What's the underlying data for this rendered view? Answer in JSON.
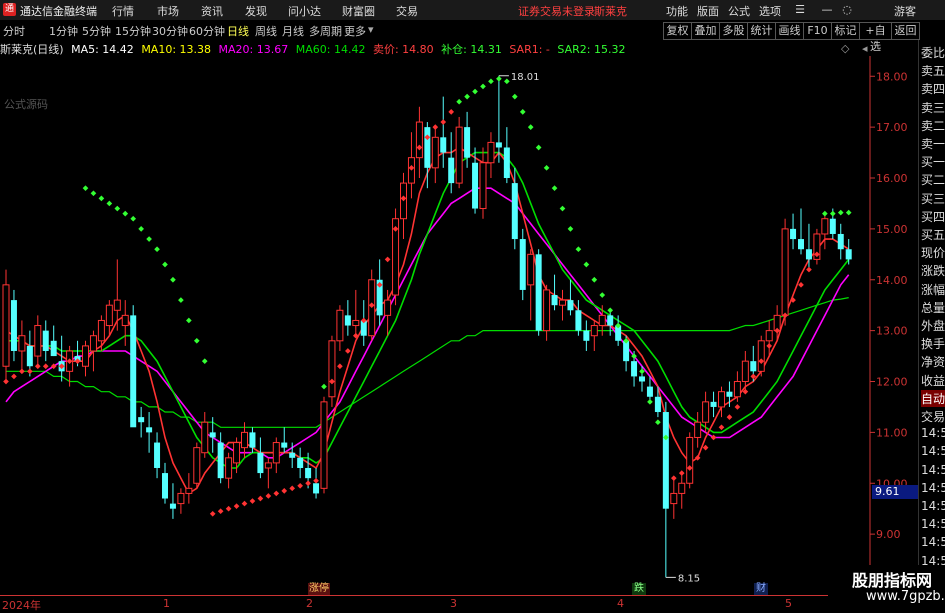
{
  "app": {
    "title": "通达信金融终端",
    "menu": [
      "行情",
      "市场",
      "资讯",
      "发现",
      "问小达",
      "财富圈",
      "交易"
    ],
    "notice": "证券交易未登录",
    "stock_name": "斯莱克",
    "right_menu": [
      "功能",
      "版面",
      "公式",
      "选项"
    ],
    "user": "游客"
  },
  "periods": [
    "分时",
    "1分钟",
    "5分钟",
    "15分钟",
    "30分钟",
    "60分钟",
    "日线",
    "周线",
    "月线",
    "多周期",
    "更多"
  ],
  "active_period": "日线",
  "toolbar": [
    "复权",
    "叠加",
    "多股",
    "统计",
    "画线",
    "F10",
    "标记",
    "+自选",
    "返回"
  ],
  "legend": {
    "name": "斯莱克(日线)",
    "ma5": "MA5: 14.42",
    "ma10": "MA10: 13.38",
    "ma20": "MA20: 13.67",
    "ma60": "MA60: 14.42",
    "sell": "卖价: 14.80",
    "add": "补仓: 14.31",
    "sar1": "SAR1: -",
    "sar2": "SAR2: 15.32",
    "formula_label": "公式源码"
  },
  "annotations": {
    "high": "18.01",
    "low": "8.15",
    "current": "9.61"
  },
  "yaxis": [
    "18.00",
    "17.00",
    "16.00",
    "15.00",
    "14.00",
    "13.00",
    "12.00",
    "11.00",
    "10.00",
    "9.00"
  ],
  "yvalues": [
    18,
    17,
    16,
    15,
    14,
    13,
    12,
    11,
    10,
    9
  ],
  "xaxis": [
    "2024年",
    "1",
    "2",
    "3",
    "4",
    "5"
  ],
  "events": [
    "涨停",
    "跌",
    "财"
  ],
  "right_panel": [
    "委比",
    "卖五",
    "卖四",
    "卖三",
    "卖二",
    "卖一",
    "买一",
    "买二",
    "买三",
    "买四",
    "买五",
    "现价",
    "涨跌",
    "涨幅",
    "总量",
    "外盘",
    "换手",
    "净资",
    "收益",
    "自动",
    "交易",
    "14:56",
    "14:56",
    "14:56",
    "14:56",
    "14:56",
    "14:56",
    "14:56",
    "14:56",
    "14:56"
  ],
  "watermark": {
    "line1": "股朋指标网",
    "line2": "www.7gpzb.com"
  },
  "colors": {
    "up": "#ff3333",
    "down": "#55ffff",
    "ma5": "#ffffff",
    "ma10": "#ffff00",
    "ma20": "#ff00ff",
    "ma60": "#00dd00",
    "sar_green": "#33ff33",
    "sar_red": "#ff3333"
  },
  "chart_data": {
    "type": "candlestick",
    "ylim": [
      8.0,
      18.3
    ],
    "ohlc": [
      [
        12.3,
        14.2,
        12.0,
        13.9
      ],
      [
        13.6,
        13.8,
        12.4,
        12.6
      ],
      [
        12.6,
        13.2,
        12.2,
        12.9
      ],
      [
        12.7,
        13.0,
        12.1,
        12.3
      ],
      [
        12.5,
        13.3,
        12.3,
        13.1
      ],
      [
        13.0,
        13.2,
        12.4,
        12.6
      ],
      [
        12.8,
        13.1,
        12.5,
        12.5
      ],
      [
        12.4,
        12.9,
        12.0,
        12.2
      ],
      [
        12.2,
        12.7,
        11.9,
        12.6
      ],
      [
        12.5,
        12.8,
        12.3,
        12.4
      ],
      [
        12.3,
        12.8,
        12.1,
        12.7
      ],
      [
        12.6,
        13.0,
        12.2,
        12.9
      ],
      [
        12.8,
        13.3,
        12.6,
        13.2
      ],
      [
        13.1,
        13.6,
        12.9,
        13.5
      ],
      [
        13.4,
        14.4,
        13.0,
        13.6
      ],
      [
        13.1,
        13.6,
        12.7,
        13.3
      ],
      [
        13.3,
        13.5,
        11.8,
        11.1
      ],
      [
        11.3,
        11.5,
        10.9,
        11.2
      ],
      [
        11.1,
        11.4,
        10.6,
        11.0
      ],
      [
        10.8,
        11.0,
        10.1,
        10.3
      ],
      [
        10.2,
        10.4,
        9.6,
        9.7
      ],
      [
        9.6,
        10.0,
        9.3,
        9.5
      ],
      [
        9.6,
        9.9,
        9.4,
        9.8
      ],
      [
        9.8,
        10.2,
        9.6,
        9.9
      ],
      [
        10.0,
        10.8,
        9.9,
        10.7
      ],
      [
        10.6,
        11.4,
        10.5,
        11.2
      ],
      [
        11.0,
        11.3,
        10.6,
        10.9
      ],
      [
        10.8,
        11.0,
        10.0,
        10.1
      ],
      [
        10.1,
        10.6,
        9.9,
        10.5
      ],
      [
        10.4,
        10.9,
        10.2,
        10.8
      ],
      [
        10.7,
        11.2,
        10.5,
        11.0
      ],
      [
        11.0,
        11.1,
        10.6,
        10.7
      ],
      [
        10.6,
        10.9,
        10.1,
        10.2
      ],
      [
        10.3,
        10.5,
        9.9,
        10.4
      ],
      [
        10.4,
        10.9,
        10.2,
        10.8
      ],
      [
        10.8,
        11.1,
        10.6,
        10.7
      ],
      [
        10.6,
        10.8,
        10.3,
        10.5
      ],
      [
        10.5,
        10.7,
        10.1,
        10.3
      ],
      [
        10.3,
        10.6,
        9.9,
        10.1
      ],
      [
        10.0,
        10.3,
        9.7,
        9.8
      ],
      [
        9.9,
        11.7,
        9.8,
        11.6
      ],
      [
        11.7,
        12.9,
        11.5,
        12.8
      ],
      [
        12.8,
        13.5,
        12.6,
        13.4
      ],
      [
        13.3,
        13.6,
        12.9,
        13.1
      ],
      [
        13.1,
        13.8,
        12.9,
        13.2
      ],
      [
        13.2,
        13.6,
        12.7,
        12.9
      ],
      [
        12.9,
        14.2,
        12.8,
        14.0
      ],
      [
        14.0,
        14.4,
        13.1,
        13.3
      ],
      [
        13.3,
        13.8,
        12.9,
        13.6
      ],
      [
        13.7,
        15.4,
        13.5,
        15.2
      ],
      [
        15.2,
        16.1,
        14.8,
        15.9
      ],
      [
        15.9,
        16.9,
        15.6,
        16.4
      ],
      [
        16.4,
        17.4,
        16.0,
        17.1
      ],
      [
        17.0,
        17.1,
        15.8,
        16.2
      ],
      [
        16.2,
        17.0,
        15.9,
        16.8
      ],
      [
        16.8,
        17.6,
        16.2,
        16.5
      ],
      [
        16.4,
        16.9,
        15.7,
        15.9
      ],
      [
        15.9,
        17.2,
        15.8,
        17.0
      ],
      [
        17.0,
        17.3,
        16.2,
        16.4
      ],
      [
        16.3,
        16.6,
        15.3,
        15.4
      ],
      [
        15.4,
        16.6,
        15.2,
        16.3
      ],
      [
        16.3,
        16.9,
        16.0,
        16.7
      ],
      [
        16.7,
        18.01,
        16.3,
        16.6
      ],
      [
        16.6,
        17.0,
        15.9,
        16.0
      ],
      [
        15.9,
        16.2,
        14.6,
        14.8
      ],
      [
        14.8,
        15.0,
        13.6,
        13.8
      ],
      [
        13.9,
        14.6,
        13.2,
        14.5
      ],
      [
        14.5,
        14.6,
        12.9,
        13.0
      ],
      [
        13.0,
        13.9,
        12.8,
        13.8
      ],
      [
        13.7,
        14.1,
        13.4,
        13.5
      ],
      [
        13.5,
        13.8,
        13.2,
        13.6
      ],
      [
        13.6,
        14.0,
        13.3,
        13.4
      ],
      [
        13.4,
        13.6,
        12.9,
        13.0
      ],
      [
        13.0,
        13.2,
        12.6,
        12.8
      ],
      [
        12.9,
        13.2,
        12.6,
        13.1
      ],
      [
        13.1,
        13.5,
        12.9,
        13.3
      ],
      [
        13.3,
        13.4,
        12.9,
        13.1
      ],
      [
        13.1,
        13.3,
        12.7,
        12.8
      ],
      [
        12.8,
        12.9,
        12.2,
        12.4
      ],
      [
        12.4,
        12.6,
        11.9,
        12.1
      ],
      [
        12.1,
        12.3,
        11.8,
        12.0
      ],
      [
        11.9,
        12.1,
        11.6,
        11.7
      ],
      [
        11.7,
        11.9,
        11.3,
        11.4
      ],
      [
        11.4,
        11.6,
        8.15,
        9.5
      ],
      [
        9.6,
        10.1,
        9.3,
        9.8
      ],
      [
        9.8,
        10.2,
        9.5,
        10.0
      ],
      [
        10.0,
        11.0,
        9.9,
        10.9
      ],
      [
        10.9,
        11.4,
        10.7,
        11.2
      ],
      [
        11.2,
        11.8,
        11.0,
        11.6
      ],
      [
        11.6,
        11.8,
        11.3,
        11.5
      ],
      [
        11.5,
        11.9,
        11.3,
        11.8
      ],
      [
        11.8,
        12.0,
        11.5,
        11.7
      ],
      [
        11.7,
        12.2,
        11.6,
        12.0
      ],
      [
        12.0,
        12.6,
        11.8,
        12.4
      ],
      [
        12.4,
        12.7,
        12.0,
        12.2
      ],
      [
        12.2,
        12.9,
        12.1,
        12.8
      ],
      [
        12.8,
        13.2,
        12.5,
        13.0
      ],
      [
        13.0,
        13.5,
        12.8,
        13.3
      ],
      [
        13.3,
        15.2,
        13.1,
        15.0
      ],
      [
        15.0,
        15.3,
        14.6,
        14.8
      ],
      [
        14.8,
        15.4,
        14.5,
        14.6
      ],
      [
        14.6,
        15.1,
        14.2,
        14.4
      ],
      [
        14.4,
        15.0,
        14.3,
        14.9
      ],
      [
        14.9,
        15.3,
        14.6,
        15.2
      ],
      [
        15.2,
        15.4,
        14.8,
        14.9
      ],
      [
        14.9,
        15.1,
        14.4,
        14.6
      ],
      [
        14.6,
        14.8,
        14.3,
        14.4
      ]
    ],
    "ma5": [
      13.0,
      12.9,
      12.8,
      12.7,
      12.7,
      12.7,
      12.6,
      12.5,
      12.4,
      12.4,
      12.4,
      12.6,
      12.7,
      12.9,
      13.2,
      13.3,
      13.0,
      12.6,
      12.2,
      11.6,
      10.9,
      10.4,
      10.1,
      9.8,
      9.9,
      10.2,
      10.4,
      10.6,
      10.8,
      10.8,
      10.8,
      10.7,
      10.6,
      10.6,
      10.6,
      10.6,
      10.6,
      10.5,
      10.4,
      10.3,
      10.6,
      11.2,
      11.8,
      12.3,
      12.8,
      13.1,
      13.3,
      13.5,
      13.6,
      13.9,
      14.3,
      14.9,
      15.7,
      16.1,
      16.4,
      16.5,
      16.5,
      16.6,
      16.5,
      16.4,
      16.3,
      16.3,
      16.5,
      16.3,
      15.9,
      15.3,
      14.7,
      14.1,
      13.8,
      13.7,
      13.6,
      13.6,
      13.4,
      13.3,
      13.2,
      13.1,
      13.1,
      13.0,
      12.9,
      12.7,
      12.5,
      12.2,
      11.9,
      11.3,
      10.9,
      10.6,
      10.4,
      10.5,
      10.9,
      11.2,
      11.5,
      11.6,
      11.7,
      11.9,
      12.0,
      12.2,
      12.5,
      12.8,
      13.3,
      13.7,
      14.1,
      14.4,
      14.6,
      14.8,
      14.8,
      14.7,
      14.6
    ],
    "ma10": [
      12.8,
      12.8,
      12.8,
      12.7,
      12.7,
      12.7,
      12.7,
      12.6,
      12.6,
      12.6,
      12.6,
      12.6,
      12.6,
      12.7,
      12.8,
      12.9,
      12.9,
      12.8,
      12.6,
      12.4,
      12.1,
      11.8,
      11.5,
      11.2,
      10.9,
      10.7,
      10.5,
      10.4,
      10.3,
      10.3,
      10.5,
      10.6,
      10.6,
      10.6,
      10.6,
      10.6,
      10.6,
      10.5,
      10.5,
      10.4,
      10.5,
      10.8,
      11.1,
      11.4,
      11.7,
      12.0,
      12.3,
      12.6,
      12.9,
      13.2,
      13.6,
      14.0,
      14.5,
      14.9,
      15.3,
      15.7,
      16.0,
      16.3,
      16.4,
      16.5,
      16.5,
      16.5,
      16.5,
      16.4,
      16.2,
      15.9,
      15.5,
      15.1,
      14.8,
      14.5,
      14.2,
      14.0,
      13.8,
      13.6,
      13.5,
      13.4,
      13.3,
      13.2,
      13.1,
      13.0,
      12.8,
      12.6,
      12.4,
      12.1,
      11.8,
      11.5,
      11.3,
      11.2,
      11.1,
      11.0,
      11.0,
      11.1,
      11.2,
      11.3,
      11.4,
      11.6,
      11.8,
      12.0,
      12.3,
      12.6,
      12.9,
      13.2,
      13.5,
      13.8,
      14.0,
      14.2,
      14.4
    ],
    "ma20": [
      11.6,
      11.8,
      11.9,
      12.0,
      12.1,
      12.2,
      12.3,
      12.4,
      12.4,
      12.5,
      12.5,
      12.6,
      12.6,
      12.6,
      12.6,
      12.6,
      12.5,
      12.4,
      12.3,
      12.2,
      12.0,
      11.8,
      11.6,
      11.4,
      11.2,
      11.0,
      10.9,
      10.8,
      10.7,
      10.6,
      10.6,
      10.6,
      10.6,
      10.5,
      10.5,
      10.6,
      10.7,
      10.8,
      10.9,
      11.0,
      11.2,
      11.4,
      11.6,
      11.9,
      12.2,
      12.5,
      12.8,
      13.1,
      13.4,
      13.7,
      14.0,
      14.3,
      14.6,
      14.9,
      15.1,
      15.3,
      15.5,
      15.6,
      15.7,
      15.8,
      15.8,
      15.8,
      15.7,
      15.6,
      15.5,
      15.3,
      15.1,
      14.9,
      14.7,
      14.5,
      14.3,
      14.1,
      13.9,
      13.7,
      13.5,
      13.3,
      13.1,
      12.9,
      12.7,
      12.5,
      12.3,
      12.1,
      11.9,
      11.7,
      11.5,
      11.3,
      11.2,
      11.1,
      11.0,
      10.9,
      10.9,
      10.9,
      11.0,
      11.1,
      11.2,
      11.3,
      11.5,
      11.7,
      11.9,
      12.1,
      12.4,
      12.7,
      13.0,
      13.3,
      13.6,
      13.9,
      14.1
    ],
    "ma60": [
      12.2,
      12.2,
      12.2,
      12.2,
      12.2,
      12.2,
      12.1,
      12.1,
      12.0,
      12.0,
      11.9,
      11.9,
      11.8,
      11.8,
      11.7,
      11.7,
      11.6,
      11.6,
      11.5,
      11.5,
      11.4,
      11.4,
      11.3,
      11.3,
      11.2,
      11.2,
      11.2,
      11.1,
      11.1,
      11.1,
      11.1,
      11.1,
      11.1,
      11.1,
      11.1,
      11.1,
      11.1,
      11.1,
      11.1,
      11.1,
      11.2,
      11.3,
      11.4,
      11.5,
      11.6,
      11.7,
      11.8,
      11.9,
      12.0,
      12.1,
      12.2,
      12.3,
      12.4,
      12.5,
      12.6,
      12.7,
      12.8,
      12.8,
      12.9,
      12.9,
      13.0,
      13.0,
      13.0,
      13.0,
      13.0,
      13.0,
      13.0,
      13.0,
      13.0,
      13.0,
      13.0,
      13.0,
      13.0,
      13.0,
      13.0,
      13.0,
      13.0,
      13.0,
      13.0,
      13.0,
      13.0,
      13.0,
      13.0,
      13.0,
      13.0,
      13.0,
      13.0,
      13.0,
      13.0,
      13.0,
      13.0,
      13.0,
      13.05,
      13.1,
      13.1,
      13.15,
      13.2,
      13.25,
      13.3,
      13.35,
      13.4,
      13.45,
      13.5,
      13.55,
      13.6,
      13.62,
      13.65
    ],
    "sar": [
      [
        12.0,
        "r"
      ],
      [
        12.1,
        "r"
      ],
      [
        12.2,
        "r"
      ],
      [
        12.2,
        "r"
      ],
      [
        12.3,
        "r"
      ],
      [
        12.3,
        "r"
      ],
      [
        12.3,
        "r"
      ],
      [
        12.3,
        "r"
      ],
      [
        12.4,
        "r"
      ],
      [
        12.4,
        "r"
      ],
      [
        15.8,
        "g"
      ],
      [
        15.7,
        "g"
      ],
      [
        15.6,
        "g"
      ],
      [
        15.5,
        "g"
      ],
      [
        15.4,
        "g"
      ],
      [
        15.3,
        "g"
      ],
      [
        15.2,
        "g"
      ],
      [
        15.0,
        "g"
      ],
      [
        14.8,
        "g"
      ],
      [
        14.6,
        "g"
      ],
      [
        14.3,
        "g"
      ],
      [
        14.0,
        "g"
      ],
      [
        13.6,
        "g"
      ],
      [
        13.2,
        "g"
      ],
      [
        12.8,
        "g"
      ],
      [
        12.4,
        "g"
      ],
      [
        9.4,
        "r"
      ],
      [
        9.45,
        "r"
      ],
      [
        9.5,
        "r"
      ],
      [
        9.55,
        "r"
      ],
      [
        9.6,
        "r"
      ],
      [
        9.65,
        "r"
      ],
      [
        9.7,
        "r"
      ],
      [
        9.75,
        "r"
      ],
      [
        9.8,
        "r"
      ],
      [
        9.85,
        "r"
      ],
      [
        9.9,
        "r"
      ],
      [
        9.95,
        "r"
      ],
      [
        10.0,
        "r"
      ],
      [
        10.05,
        "r"
      ],
      [
        11.9,
        "g"
      ],
      [
        12.0,
        "r"
      ],
      [
        12.3,
        "r"
      ],
      [
        12.6,
        "r"
      ],
      [
        12.9,
        "r"
      ],
      [
        13.2,
        "r"
      ],
      [
        13.5,
        "r"
      ],
      [
        13.9,
        "r"
      ],
      [
        14.4,
        "r"
      ],
      [
        15.0,
        "r"
      ],
      [
        15.6,
        "r"
      ],
      [
        16.2,
        "r"
      ],
      [
        16.6,
        "r"
      ],
      [
        16.8,
        "r"
      ],
      [
        17.0,
        "r"
      ],
      [
        17.1,
        "r"
      ],
      [
        17.3,
        "r"
      ],
      [
        17.5,
        "g"
      ],
      [
        17.6,
        "g"
      ],
      [
        17.7,
        "g"
      ],
      [
        17.8,
        "g"
      ],
      [
        17.9,
        "g"
      ],
      [
        17.95,
        "g"
      ],
      [
        17.9,
        "g"
      ],
      [
        17.6,
        "g"
      ],
      [
        17.3,
        "g"
      ],
      [
        17.0,
        "g"
      ],
      [
        16.6,
        "g"
      ],
      [
        16.2,
        "g"
      ],
      [
        15.8,
        "g"
      ],
      [
        15.4,
        "g"
      ],
      [
        15.0,
        "g"
      ],
      [
        14.6,
        "g"
      ],
      [
        14.3,
        "g"
      ],
      [
        14.0,
        "g"
      ],
      [
        13.7,
        "g"
      ],
      [
        13.4,
        "g"
      ],
      [
        13.1,
        "g"
      ],
      [
        12.8,
        "g"
      ],
      [
        12.5,
        "g"
      ],
      [
        12.2,
        "g"
      ],
      [
        11.6,
        "g"
      ],
      [
        11.2,
        "g"
      ],
      [
        10.9,
        "g"
      ],
      [
        10.1,
        "r"
      ],
      [
        10.2,
        "r"
      ],
      [
        10.3,
        "r"
      ],
      [
        10.5,
        "r"
      ],
      [
        10.7,
        "r"
      ],
      [
        10.9,
        "r"
      ],
      [
        11.1,
        "r"
      ],
      [
        11.3,
        "r"
      ],
      [
        11.5,
        "r"
      ],
      [
        11.8,
        "r"
      ],
      [
        12.1,
        "r"
      ],
      [
        12.4,
        "r"
      ],
      [
        12.7,
        "r"
      ],
      [
        13.0,
        "r"
      ],
      [
        13.3,
        "r"
      ],
      [
        13.6,
        "r"
      ],
      [
        13.9,
        "r"
      ],
      [
        14.2,
        "r"
      ],
      [
        14.5,
        "r"
      ],
      [
        15.3,
        "g"
      ],
      [
        15.3,
        "g"
      ],
      [
        15.32,
        "g"
      ],
      [
        15.32,
        "g"
      ]
    ]
  }
}
